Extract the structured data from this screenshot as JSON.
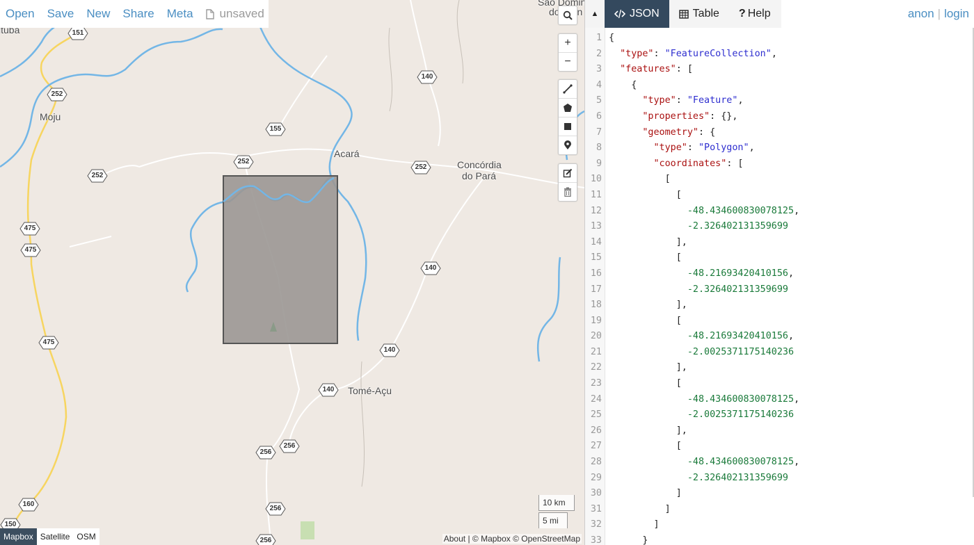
{
  "toolbar": {
    "open": "Open",
    "save": "Save",
    "new": "New",
    "share": "Share",
    "meta": "Meta",
    "status": "unsaved"
  },
  "map": {
    "places": [
      {
        "name": "Moju"
      },
      {
        "name": "Acará"
      },
      {
        "name": "Concórdia"
      },
      {
        "name": "do Pará"
      },
      {
        "name": "Tomé-Açu"
      },
      {
        "name": "São Domin"
      },
      {
        "name": "do Cain"
      },
      {
        "name": "ituba"
      }
    ],
    "road_shields": [
      "151",
      "252",
      "155",
      "140",
      "252",
      "252",
      "252",
      "475",
      "475",
      "475",
      "140",
      "140",
      "140",
      "256",
      "256",
      "256",
      "150",
      "160",
      "256"
    ],
    "controls": [
      "search-icon",
      "zoom-in-icon",
      "zoom-out-icon",
      "draw-line-icon",
      "draw-polygon-icon",
      "draw-rectangle-icon",
      "draw-marker-icon",
      "edit-layers-icon",
      "delete-layers-icon"
    ],
    "zoom_in": "+",
    "zoom_out": "−",
    "scale_km": "10 km",
    "scale_mi": "5 mi",
    "layers": [
      "Mapbox",
      "Satellite",
      "OSM"
    ],
    "active_layer": "Mapbox",
    "attribution": "About | © Mapbox © OpenStreetMap",
    "polygon_fill": "#9b9794",
    "water_color": "#73b6e6",
    "road_color": "#f7d560"
  },
  "pane": {
    "tabs": [
      {
        "label": "JSON",
        "icon": "code-icon"
      },
      {
        "label": "Table",
        "icon": "table-icon"
      },
      {
        "label": "Help",
        "icon": "question-icon"
      }
    ],
    "active_tab": "JSON",
    "user": {
      "anon": "anon",
      "sep": "|",
      "login": "login"
    },
    "accent": "#34495e"
  },
  "editor": {
    "lines": [
      {
        "n": "1",
        "code": "{"
      },
      {
        "n": "2",
        "code": "  \"type\": \"FeatureCollection\","
      },
      {
        "n": "3",
        "code": "  \"features\": ["
      },
      {
        "n": "4",
        "code": "    {"
      },
      {
        "n": "5",
        "code": "      \"type\": \"Feature\","
      },
      {
        "n": "6",
        "code": "      \"properties\": {},"
      },
      {
        "n": "7",
        "code": "      \"geometry\": {"
      },
      {
        "n": "8",
        "code": "        \"type\": \"Polygon\","
      },
      {
        "n": "9",
        "code": "        \"coordinates\": ["
      },
      {
        "n": "10",
        "code": "          ["
      },
      {
        "n": "11",
        "code": "            ["
      },
      {
        "n": "12",
        "code": "              -48.434600830078125,"
      },
      {
        "n": "13",
        "code": "              -2.326402131359699"
      },
      {
        "n": "14",
        "code": "            ],"
      },
      {
        "n": "15",
        "code": "            ["
      },
      {
        "n": "16",
        "code": "              -48.21693420410156,"
      },
      {
        "n": "17",
        "code": "              -2.326402131359699"
      },
      {
        "n": "18",
        "code": "            ],"
      },
      {
        "n": "19",
        "code": "            ["
      },
      {
        "n": "20",
        "code": "              -48.21693420410156,"
      },
      {
        "n": "21",
        "code": "              -2.0025371175140236"
      },
      {
        "n": "22",
        "code": "            ],"
      },
      {
        "n": "23",
        "code": "            ["
      },
      {
        "n": "24",
        "code": "              -48.434600830078125,"
      },
      {
        "n": "25",
        "code": "              -2.0025371175140236"
      },
      {
        "n": "26",
        "code": "            ],"
      },
      {
        "n": "27",
        "code": "            ["
      },
      {
        "n": "28",
        "code": "              -48.434600830078125,"
      },
      {
        "n": "29",
        "code": "              -2.326402131359699"
      },
      {
        "n": "30",
        "code": "            ]"
      },
      {
        "n": "31",
        "code": "          ]"
      },
      {
        "n": "32",
        "code": "        ]"
      },
      {
        "n": "33",
        "code": "      }"
      }
    ]
  }
}
